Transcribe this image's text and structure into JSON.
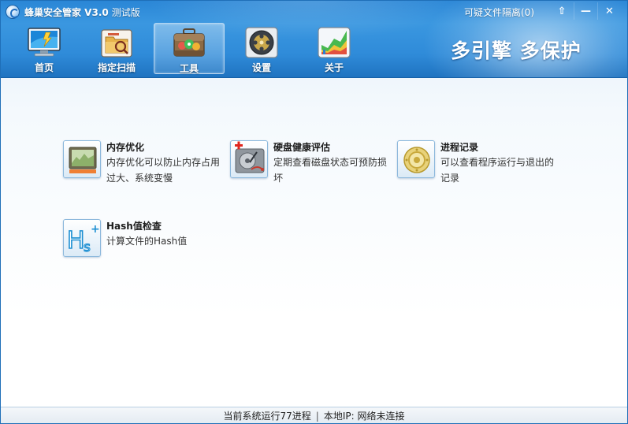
{
  "app": {
    "title": "蜂巢安全管家 V3.0",
    "edition": "测试版",
    "quarantine": "可疑文件隔离(0)",
    "window_buttons": {
      "pin": "⇧",
      "minimize": "—",
      "close": "✕"
    }
  },
  "nav": {
    "items": [
      {
        "label": "首页",
        "icon": "monitor-icon"
      },
      {
        "label": "指定扫描",
        "icon": "folder-scan-icon"
      },
      {
        "label": "工具",
        "icon": "toolbox-icon",
        "active": true
      },
      {
        "label": "设置",
        "icon": "gear-film-icon"
      },
      {
        "label": "关于",
        "icon": "chart-icon"
      }
    ]
  },
  "slogan": "多引擎 多保护",
  "tools": [
    {
      "name": "内存优化",
      "desc": "内存优化可以防止内存占用过大、系统变慢",
      "icon": "memory-icon"
    },
    {
      "name": "硬盘健康评估",
      "desc": "定期查看磁盘状态可预防损坏",
      "icon": "harddisk-icon"
    },
    {
      "name": "进程记录",
      "desc": "可以查看程序运行与退出的记录",
      "icon": "process-icon"
    },
    {
      "name": "Hash值检查",
      "desc": "计算文件的Hash值",
      "icon": "hash-icon"
    }
  ],
  "status": {
    "processes": "当前系统运行77进程",
    "separator": "|",
    "ip": "本地IP: 网络未连接"
  },
  "colors": {
    "header": "#2f8bd9",
    "accent": "#1f73c0"
  }
}
